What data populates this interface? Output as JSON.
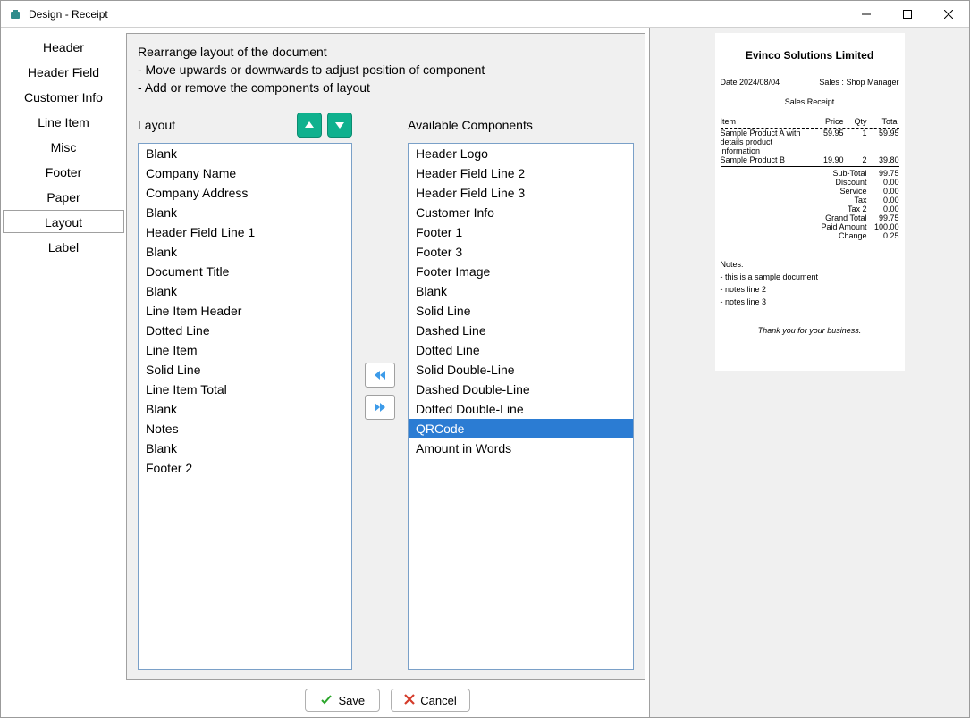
{
  "titlebar": {
    "title": "Design - Receipt"
  },
  "sidebar": {
    "items": [
      {
        "label": "Header"
      },
      {
        "label": "Header Field"
      },
      {
        "label": "Customer Info"
      },
      {
        "label": "Line Item"
      },
      {
        "label": "Misc"
      },
      {
        "label": "Footer"
      },
      {
        "label": "Paper"
      },
      {
        "label": "Layout"
      },
      {
        "label": "Label"
      }
    ],
    "selected_index": 7
  },
  "instructions": {
    "l1": "Rearrange layout of the document",
    "l2": "- Move upwards or downwards to adjust position of component",
    "l3": "- Add or remove the components of layout"
  },
  "layout_col": {
    "label": "Layout",
    "items": [
      "Blank",
      "Company Name",
      "Company Address",
      "Blank",
      "Header Field Line 1",
      "Blank",
      "Document Title",
      "Blank",
      "Line Item Header",
      "Dotted Line",
      "Line Item",
      "Solid Line",
      "Line Item Total",
      "Blank",
      "Notes",
      "Blank",
      "Footer 2"
    ]
  },
  "avail_col": {
    "label": "Available Components",
    "items": [
      "Header Logo",
      "Header Field Line 2",
      "Header Field Line 3",
      "Customer Info",
      "Footer 1",
      "Footer 3",
      "Footer Image",
      "Blank",
      "Solid Line",
      "Dashed Line",
      "Dotted Line",
      "Solid Double-Line",
      "Dashed Double-Line",
      "Dotted Double-Line",
      "QRCode",
      "Amount in Words"
    ],
    "selected_index": 14
  },
  "buttons": {
    "save": "Save",
    "cancel": "Cancel"
  },
  "preview": {
    "company": "Evinco Solutions Limited",
    "date_label": "Date",
    "date_value": "2024/08/04",
    "sales_label": "Sales :",
    "sales_value": "Shop Manager",
    "doc_title": "Sales Receipt",
    "headers": {
      "item": "Item",
      "price": "Price",
      "qty": "Qty",
      "total": "Total"
    },
    "lines": [
      {
        "name": "Sample Product A with",
        "price": "59.95",
        "qty": "1",
        "total": "59.95"
      },
      {
        "name": "details product information",
        "price": "",
        "qty": "",
        "total": ""
      },
      {
        "name": "Sample Product B",
        "price": "19.90",
        "qty": "2",
        "total": "39.80"
      }
    ],
    "totals": [
      {
        "label": "Sub-Total",
        "value": "99.75"
      },
      {
        "label": "Discount",
        "value": "0.00"
      },
      {
        "label": "Service",
        "value": "0.00"
      },
      {
        "label": "Tax",
        "value": "0.00"
      },
      {
        "label": "Tax 2",
        "value": "0.00"
      },
      {
        "label": "Grand Total",
        "value": "99.75"
      },
      {
        "label": "Paid Amount",
        "value": "100.00"
      },
      {
        "label": "Change",
        "value": "0.25"
      }
    ],
    "notes_label": "Notes:",
    "notes": [
      "- this is a sample document",
      "- notes line 2",
      "- notes line 3"
    ],
    "thanks": "Thank you for your business."
  }
}
